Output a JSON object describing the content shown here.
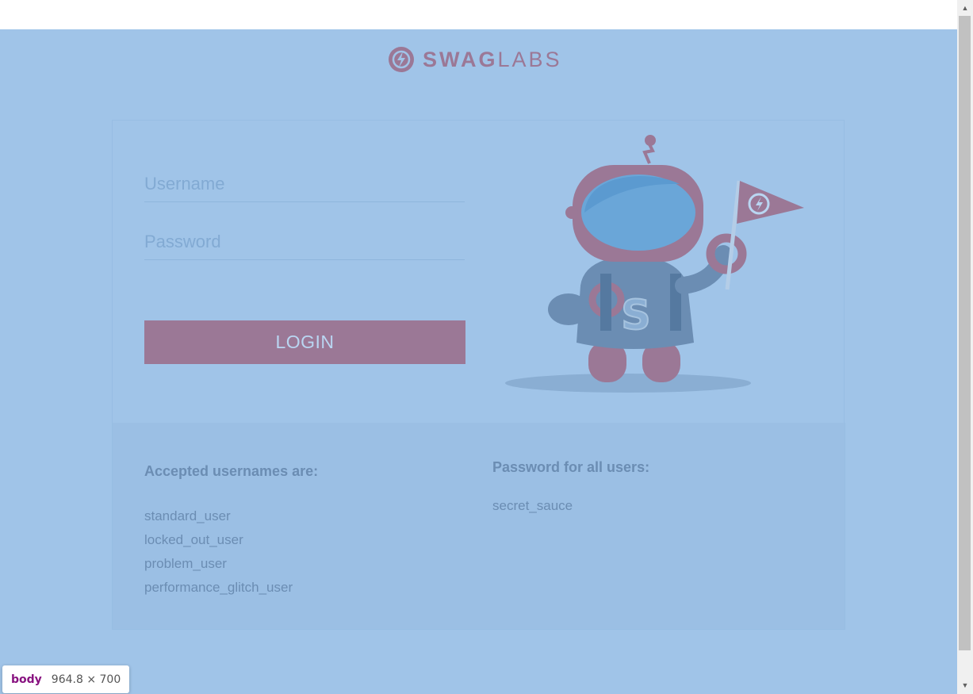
{
  "logo": {
    "text_bold": "SWAG",
    "text_light": "LABS",
    "icon": "swag-labs-logo-icon"
  },
  "login": {
    "username_placeholder": "Username",
    "password_placeholder": "Password",
    "button_label": "LOGIN"
  },
  "credentials": {
    "users_heading": "Accepted usernames are:",
    "users": [
      "standard_user",
      "locked_out_user",
      "problem_user",
      "performance_glitch_user"
    ],
    "password_heading": "Password for all users:",
    "password": "secret_sauce"
  },
  "devtools": {
    "tag": "body",
    "dimensions": "964.8 × 700"
  },
  "colors": {
    "overlay_blue": "#a0c4e8",
    "accent_mauve": "#9b7896",
    "text_blue": "#6b8db3"
  }
}
